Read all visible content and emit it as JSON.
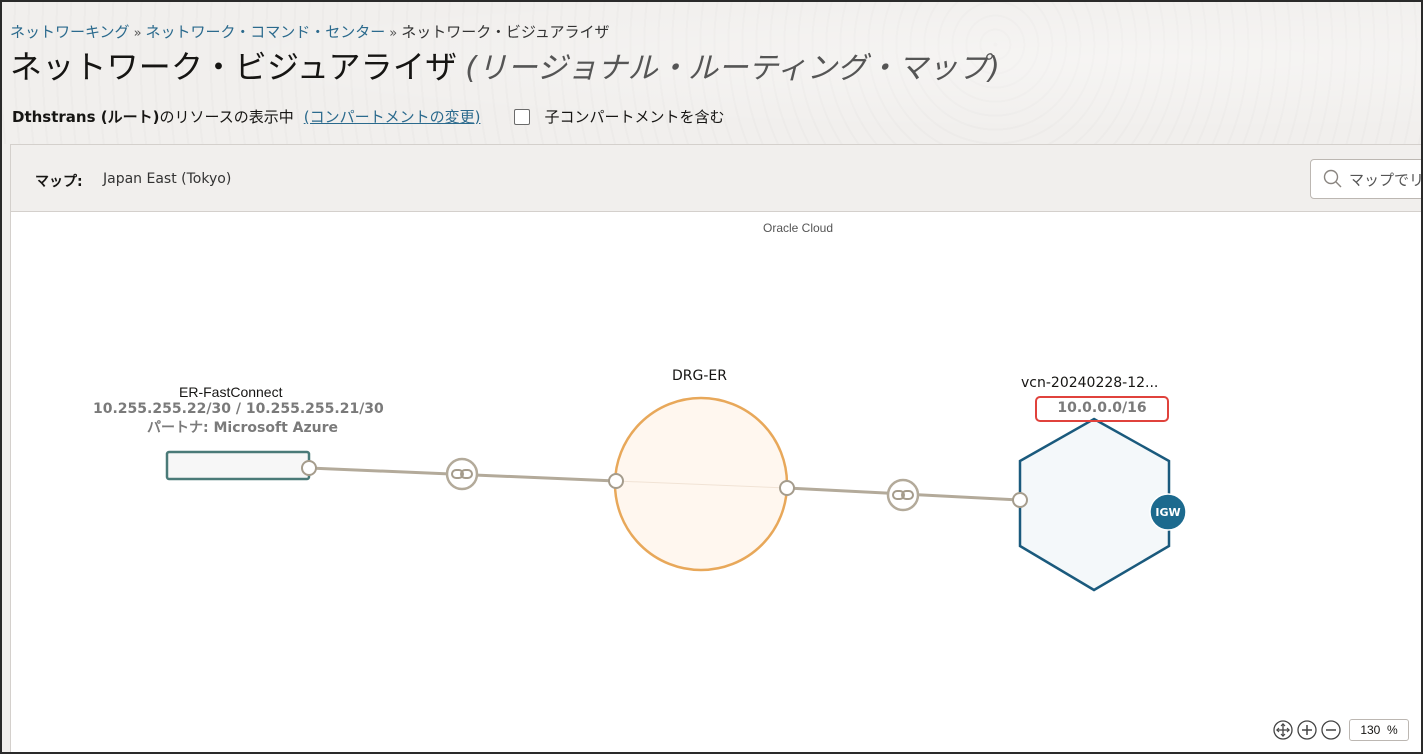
{
  "breadcrumb": {
    "items": [
      "ネットワーキング",
      "ネットワーク・コマンド・センター"
    ],
    "separator": "»",
    "current": "ネットワーク・ビジュアライザ"
  },
  "page": {
    "title": "ネットワーク・ビジュアライザ",
    "subtitle": "(リージョナル・ルーティング・マップ)"
  },
  "scope": {
    "compartment_name": "Dthstrans (ルート)",
    "compartment_suffix": "のリソースの表示中",
    "change_link": "(コンパートメントの変更)",
    "include_children_label": "子コンパートメントを含む",
    "include_children_checked": false
  },
  "map": {
    "label": "マップ:",
    "region": "Japan East (Tokyo)",
    "search_placeholder": "マップでリ",
    "cloud_label": "Oracle Cloud"
  },
  "nodes": {
    "fastconnect": {
      "name": "ER-FastConnect",
      "ip": "10.255.255.22/30 / 10.255.255.21/30",
      "partner": "パートナ: Microsoft Azure"
    },
    "drg": {
      "name": "DRG-ER"
    },
    "vcn": {
      "name": "vcn-20240228-12...",
      "cidr": "10.0.0.0/16",
      "gateway_badge": "IGW"
    }
  },
  "zoom": {
    "value": "130",
    "unit": "%"
  },
  "colors": {
    "link": "#2b6a8d",
    "drg_stroke": "#e8a85a",
    "drg_fill": "#fff7ef",
    "vcn_stroke": "#1a5a7d",
    "vcn_fill": "#f4f8fa",
    "fc_stroke": "#4a7a78",
    "connector": "#b3aa9a",
    "highlight": "#e0423c"
  }
}
